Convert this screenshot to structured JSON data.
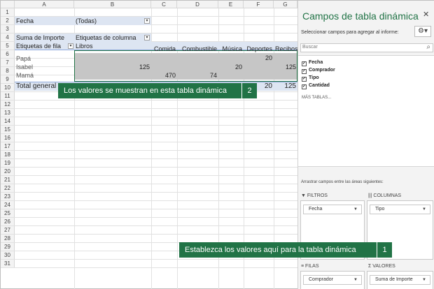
{
  "columns": [
    "A",
    "B",
    "C",
    "D",
    "E",
    "F",
    "G"
  ],
  "rows": [
    "1",
    "2",
    "3",
    "4",
    "5",
    "6",
    "7",
    "8",
    "9",
    "10",
    "11",
    "12",
    "13",
    "14",
    "15",
    "16",
    "17",
    "18",
    "19",
    "20",
    "21",
    "22",
    "23",
    "24",
    "25",
    "26",
    "27",
    "28",
    "29",
    "30",
    "31"
  ],
  "filter": {
    "label": "Fecha",
    "value": "(Todas)"
  },
  "pivot": {
    "value_header": "Suma de Importe",
    "col_labels": "Etiquetas de columna",
    "row_labels": "Etiquetas de fila",
    "first_col": "Libros",
    "cols": [
      "Comida",
      "Combustible",
      "Música",
      "Deportes",
      "Recibos"
    ],
    "row_items": [
      "Papá",
      "Isabel",
      "Mamá"
    ],
    "total_label": "Total general",
    "values": {
      "papa_deportes": "20",
      "isabel_libros": "125",
      "isabel_musica": "20",
      "isabel_recibos": "125",
      "mama_comida": "470",
      "mama_combustible": "74",
      "total_deportes": "20",
      "total_recibos": "125"
    }
  },
  "callout1": {
    "text": "Establezca los valores aquí para la tabla dinámica",
    "num": "1"
  },
  "callout2": {
    "text": "Los valores se muestran en esta tabla dinámica",
    "num": "2"
  },
  "panel": {
    "title": "Campos de tabla dinámica",
    "subtitle": "Seleccionar campos para agregar al informe:",
    "search_placeholder": "Buscar",
    "fields": [
      {
        "name": "Fecha",
        "checked": true
      },
      {
        "name": "Comprador",
        "checked": true
      },
      {
        "name": "Tipo",
        "checked": true
      },
      {
        "name": "Cantidad",
        "checked": true
      }
    ],
    "more_tables": "MÁS TABLAS...",
    "drag_text": "Arrastrar campos entre las áreas siguientes:",
    "areas": {
      "filters": {
        "title": "FILTROS",
        "item": "Fecha",
        "icon": "filter-icon"
      },
      "columns": {
        "title": "COLUMNAS",
        "item": "Tipo",
        "icon": "columns-icon"
      },
      "rows": {
        "title": "FILAS",
        "item": "Comprador",
        "icon": "rows-icon"
      },
      "values": {
        "title": "VALORES",
        "item": "Suma de Importe",
        "icon": "sigma-icon"
      }
    }
  },
  "colors": {
    "accent": "#217346",
    "pivot_header": "#dde5f2",
    "data_gray": "#c6c6c6"
  }
}
